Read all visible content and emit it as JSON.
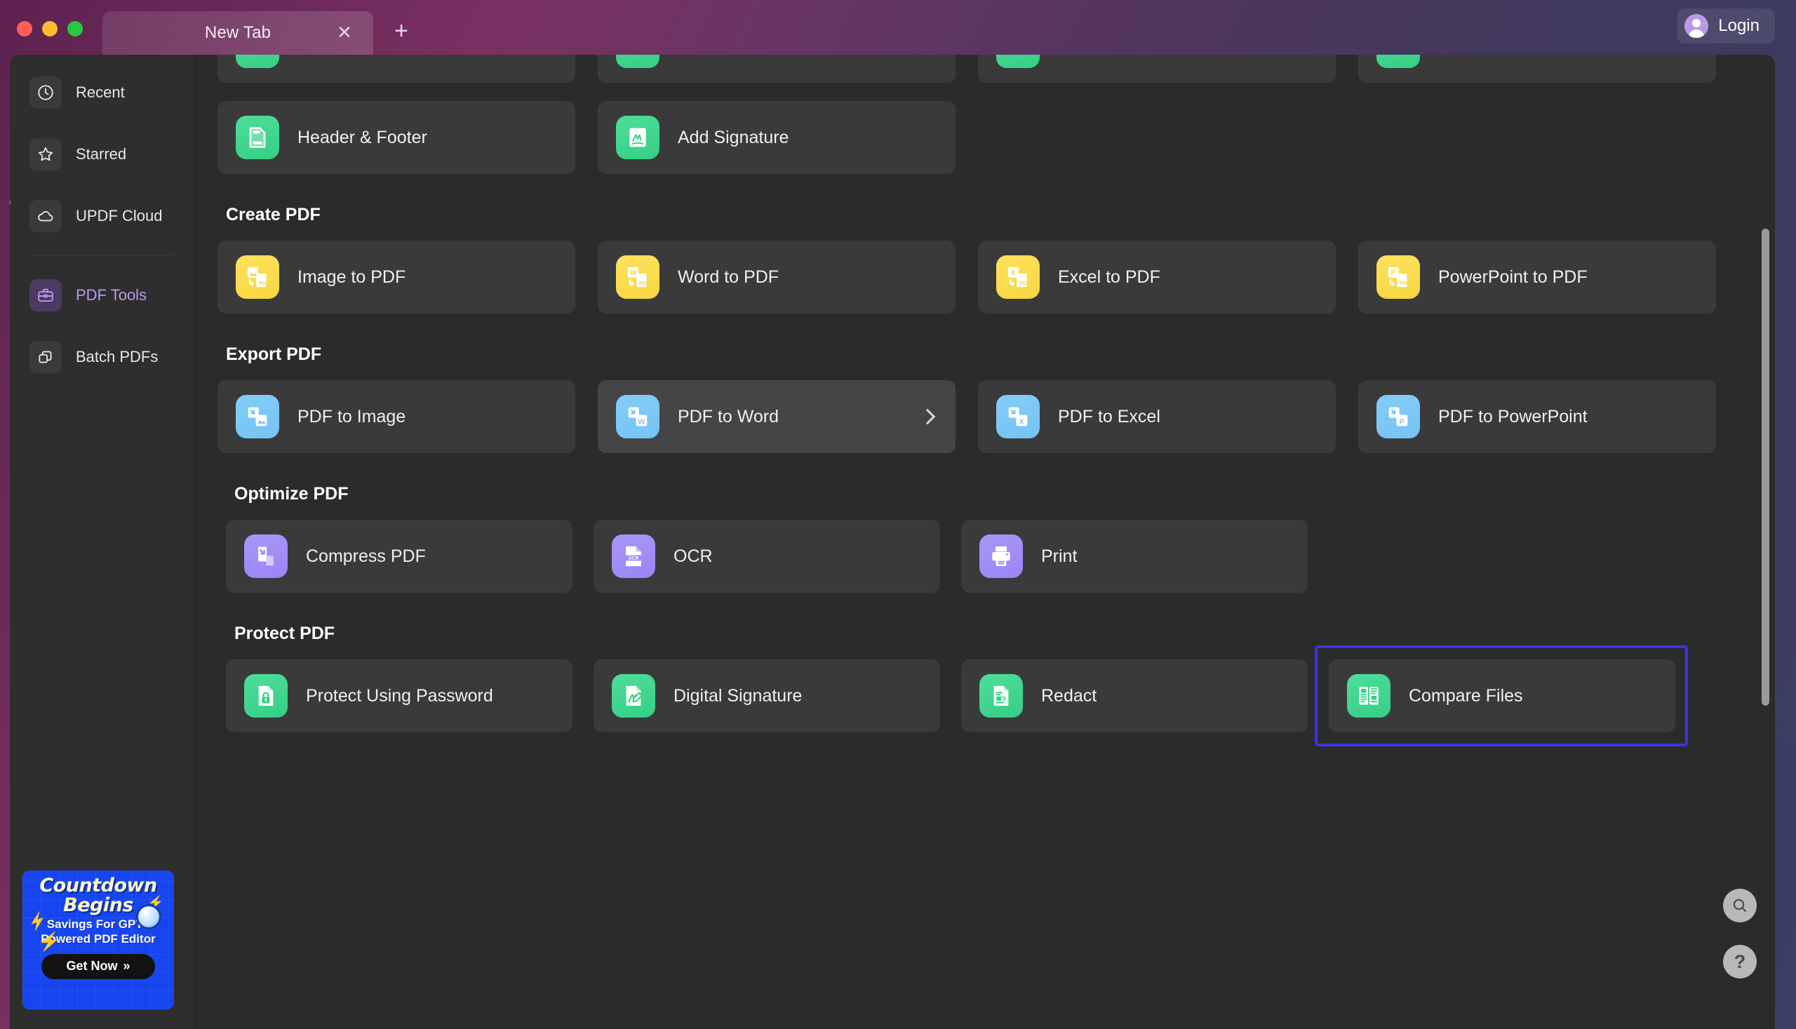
{
  "titlebar": {
    "traffic_lights": [
      "close",
      "minimize",
      "maximize"
    ],
    "tab_label": "New Tab",
    "tab_close_glyph": "✕",
    "new_tab_glyph": "+",
    "login_label": "Login"
  },
  "sidebar": {
    "items": [
      {
        "id": "recent",
        "label": "Recent",
        "icon": "clock-icon",
        "active": false
      },
      {
        "id": "starred",
        "label": "Starred",
        "icon": "star-icon",
        "active": false
      },
      {
        "id": "updf-cloud",
        "label": "UPDF Cloud",
        "icon": "cloud-icon",
        "active": false
      },
      {
        "id": "pdf-tools",
        "label": "PDF Tools",
        "icon": "briefcase-icon",
        "active": true
      },
      {
        "id": "batch-pdfs",
        "label": "Batch PDFs",
        "icon": "layers-icon",
        "active": false
      }
    ],
    "promo": {
      "line1": "Countdown",
      "line2": "Begins",
      "subtitle": "Savings For GPT4 Powered PDF Editor",
      "cta": "Get Now",
      "cta_chevron": "»"
    }
  },
  "main": {
    "sections": [
      {
        "id": "edit-pdf-clipped",
        "title": "",
        "cards": [
          {
            "label": "",
            "icon": "edit-text-icon",
            "color": "green"
          },
          {
            "label": "",
            "icon": "edit-image-icon",
            "color": "green"
          },
          {
            "label": "",
            "icon": "edit-link-icon",
            "color": "green"
          },
          {
            "label": "",
            "icon": "watermark-icon",
            "color": "green"
          }
        ]
      },
      {
        "id": "edit-pdf-row2",
        "title": "",
        "cards": [
          {
            "label": "Header & Footer",
            "icon": "header-footer-icon",
            "color": "green"
          },
          {
            "label": "Add Signature",
            "icon": "signature-icon",
            "color": "green"
          }
        ]
      },
      {
        "id": "create-pdf",
        "title": "Create PDF",
        "cards": [
          {
            "label": "Image to PDF",
            "icon": "image-to-pdf-icon",
            "color": "yellow"
          },
          {
            "label": "Word to PDF",
            "icon": "word-to-pdf-icon",
            "color": "yellow"
          },
          {
            "label": "Excel to PDF",
            "icon": "excel-to-pdf-icon",
            "color": "yellow"
          },
          {
            "label": "PowerPoint to PDF",
            "icon": "powerpoint-to-pdf-icon",
            "color": "yellow"
          }
        ]
      },
      {
        "id": "export-pdf",
        "title": "Export PDF",
        "cards": [
          {
            "label": "PDF to Image",
            "icon": "pdf-to-image-icon",
            "color": "blue"
          },
          {
            "label": "PDF to Word",
            "icon": "pdf-to-word-icon",
            "color": "blue",
            "hovered": true,
            "has_chevron": true
          },
          {
            "label": "PDF to Excel",
            "icon": "pdf-to-excel-icon",
            "color": "blue"
          },
          {
            "label": "PDF to PowerPoint",
            "icon": "pdf-to-powerpoint-icon",
            "color": "blue"
          }
        ]
      },
      {
        "id": "optimize-pdf",
        "title": "Optimize PDF",
        "cards": [
          {
            "label": "Compress PDF",
            "icon": "compress-icon",
            "color": "purple"
          },
          {
            "label": "OCR",
            "icon": "ocr-icon",
            "color": "purple"
          },
          {
            "label": "Print",
            "icon": "print-icon",
            "color": "purple"
          }
        ]
      },
      {
        "id": "protect-pdf",
        "title": "Protect PDF",
        "cards": [
          {
            "label": "Protect Using Password",
            "icon": "lock-doc-icon",
            "color": "green"
          },
          {
            "label": "Digital Signature",
            "icon": "digital-sign-icon",
            "color": "green"
          },
          {
            "label": "Redact",
            "icon": "redact-icon",
            "color": "green"
          },
          {
            "label": "Compare Files",
            "icon": "compare-files-icon",
            "color": "green",
            "selected": true
          }
        ]
      }
    ],
    "floating": {
      "search_icon": "search-icon",
      "help_label": "?"
    }
  },
  "colors": {
    "selection_border": "#3d33e8",
    "accent_purple": "#b99bea",
    "icon_green": "#44d693",
    "icon_yellow": "#f7dc4c",
    "icon_blue": "#7cc8f6",
    "icon_purple": "#a08df6",
    "app_bg": "#2b2b2b",
    "card_bg": "#3a3a3a",
    "sidebar_bg": "#2e2e2e",
    "promo_bg": "#1745ef"
  }
}
